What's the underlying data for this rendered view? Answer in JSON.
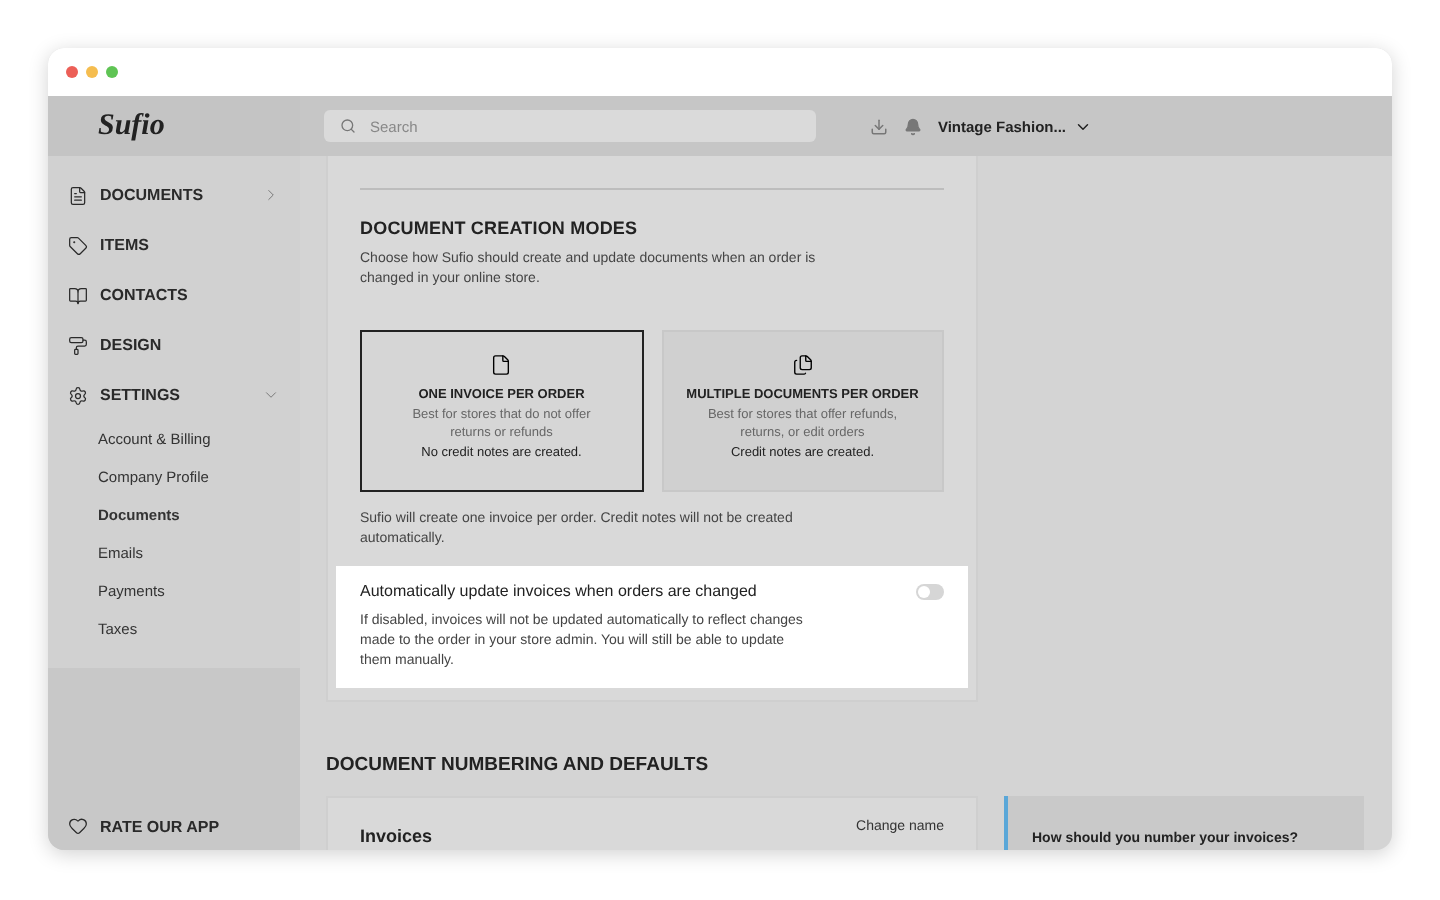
{
  "app": {
    "logo": "Sufio"
  },
  "header": {
    "search": {
      "placeholder": "Search"
    },
    "store": "Vintage Fashion..."
  },
  "sidebar": {
    "items": [
      {
        "label": "DOCUMENTS",
        "kind": "collapsible",
        "expanded": false
      },
      {
        "label": "ITEMS",
        "kind": "link"
      },
      {
        "label": "CONTACTS",
        "kind": "link"
      },
      {
        "label": "DESIGN",
        "kind": "link"
      },
      {
        "label": "SETTINGS",
        "kind": "collapsible",
        "expanded": true,
        "children": [
          {
            "label": "Account & Billing",
            "selected": false
          },
          {
            "label": "Company Profile",
            "selected": false
          },
          {
            "label": "Documents",
            "selected": true
          },
          {
            "label": "Emails",
            "selected": false
          },
          {
            "label": "Payments",
            "selected": false
          },
          {
            "label": "Taxes",
            "selected": false
          }
        ]
      }
    ],
    "footer": "RATE OUR APP"
  },
  "creation_modes": {
    "title": "DOCUMENT CREATION MODES",
    "description": "Choose how Sufio should create and update documents when an order is changed in your online store.",
    "options": [
      {
        "kind": "single",
        "title": "ONE INVOICE PER ORDER",
        "description": "Best for stores that do not offer returns or refunds",
        "note": "No credit notes are created.",
        "selected": true
      },
      {
        "kind": "multiple",
        "title": "MULTIPLE DOCUMENTS PER ORDER",
        "description": "Best for stores that offer refunds, returns, or edit orders",
        "note": "Credit notes are created.",
        "selected": false
      }
    ],
    "hint": "Sufio will create one invoice per order. Credit notes will not be created automatically.",
    "auto_update": {
      "label": "Automatically update invoices when orders are changed",
      "on": false,
      "description": "If disabled, invoices will not be updated automatically to reflect changes made to the order in your store admin. You will still be able to update them manually."
    }
  },
  "numbering": {
    "title": "DOCUMENT NUMBERING AND DEFAULTS",
    "card": {
      "title": "Invoices",
      "action": "Change name"
    },
    "aside": {
      "title": "How should you number your invoices?"
    }
  }
}
